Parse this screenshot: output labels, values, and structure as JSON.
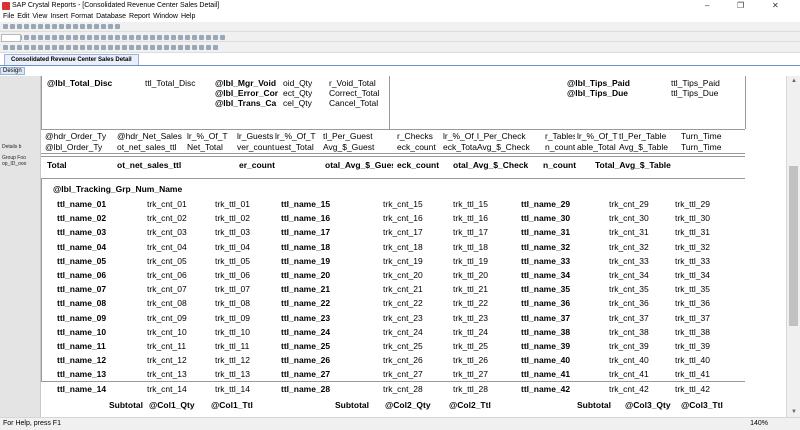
{
  "window": {
    "title": "SAP Crystal Reports - [Consolidated Revenue Center Sales Detail]",
    "minimize": "–",
    "maximize": "❐",
    "close": "✕"
  },
  "menu": [
    "File",
    "Edit",
    "View",
    "Insert",
    "Format",
    "Database",
    "Report",
    "Window",
    "Help"
  ],
  "tabs": {
    "document": "Consolidated Revenue Center Sales Detail",
    "design": "Design"
  },
  "sections": {
    "details": "Details b",
    "group_footer": "Group Foo",
    "group_footer_sub": "op_ID_ooo"
  },
  "top_block": {
    "col1": {
      "label": "@lbl_Total_Disc",
      "field": "ttl_Total_Disc"
    },
    "col2_labels": [
      "@lbl_Mgr_Void",
      "@lbl_Error_Cor",
      "@lbl_Trans_Ca"
    ],
    "col2_qty": [
      "oid_Qty",
      "ect_Qty",
      "cel_Qty"
    ],
    "col2_totals": [
      "r_Void_Total",
      "Correct_Total",
      "Cancel_Total"
    ],
    "col4_labels": [
      "@lbl_Tips_Paid",
      "@lbl_Tips_Due"
    ],
    "col4_totals": [
      "ttl_Tips_Paid",
      "ttl_Tips_Due"
    ]
  },
  "headers": [
    "@hdr_Order_Ty",
    "@hdr_Net_Sales",
    "lr_%_Of_T",
    "lr_Guests",
    "lr_%_Of_T",
    "tl_Per_Guest",
    "r_Checks",
    "lr_%_Of_T",
    "l_Per_Check",
    "r_Tables",
    "lr_%_Of_T",
    "tl_Per_Table",
    "Turn_Time"
  ],
  "detail": [
    "@lbl_Order_Ty",
    "ot_net_sales_ttl",
    "Net_Total",
    "ver_count",
    "uest_Total",
    "Avg_$_Guest",
    "eck_count",
    "eck_Total",
    "Avg_$_Check",
    "n_count",
    "able_Total",
    "Avg_$_Table",
    "Turn_Time"
  ],
  "group_footer": [
    "Total",
    "ot_net_sales_ttl",
    "er_count",
    "otal_Avg_$_Guest",
    "eck_count",
    "otal_Avg_$_Check",
    "n_count",
    "Total_Avg_$_Table"
  ],
  "tracking": {
    "title": "@lbl_Tracking_Grp_Num_Name",
    "col1": {
      "names": [
        "ttl_name_01",
        "ttl_name_02",
        "ttl_name_03",
        "ttl_name_04",
        "ttl_name_05",
        "ttl_name_06",
        "ttl_name_07",
        "ttl_name_08",
        "ttl_name_09",
        "ttl_name_10",
        "ttl_name_11",
        "ttl_name_12",
        "ttl_name_13",
        "ttl_name_14"
      ],
      "counts": [
        "trk_cnt_01",
        "trk_cnt_02",
        "trk_cnt_03",
        "trk_cnt_04",
        "trk_cnt_05",
        "trk_cnt_06",
        "trk_cnt_07",
        "trk_cnt_08",
        "trk_cnt_09",
        "trk_cnt_10",
        "trk_cnt_11",
        "trk_cnt_12",
        "trk_cnt_13",
        "trk_cnt_14"
      ],
      "totals": [
        "trk_ttl_01",
        "trk_ttl_02",
        "trk_ttl_03",
        "trk_ttl_04",
        "trk_ttl_05",
        "trk_ttl_06",
        "trk_ttl_07",
        "trk_ttl_08",
        "trk_ttl_09",
        "trk_ttl_10",
        "trk_ttl_11",
        "trk_ttl_12",
        "trk_ttl_13",
        "trk_ttl_14"
      ]
    },
    "col2": {
      "names": [
        "ttl_name_15",
        "ttl_name_16",
        "ttl_name_17",
        "ttl_name_18",
        "ttl_name_19",
        "ttl_name_20",
        "ttl_name_21",
        "ttl_name_22",
        "ttl_name_23",
        "ttl_name_24",
        "ttl_name_25",
        "ttl_name_26",
        "ttl_name_27",
        "ttl_name_28"
      ],
      "counts": [
        "trk_cnt_15",
        "trk_cnt_16",
        "trk_cnt_17",
        "trk_cnt_18",
        "trk_cnt_19",
        "trk_cnt_20",
        "trk_cnt_21",
        "trk_cnt_22",
        "trk_cnt_23",
        "trk_cnt_24",
        "trk_cnt_25",
        "trk_cnt_26",
        "trk_cnt_27",
        "trk_cnt_28"
      ],
      "totals": [
        "trk_ttl_15",
        "trk_ttl_16",
        "trk_ttl_17",
        "trk_ttl_18",
        "trk_ttl_19",
        "trk_ttl_20",
        "trk_ttl_21",
        "trk_ttl_22",
        "trk_ttl_23",
        "trk_ttl_24",
        "trk_ttl_25",
        "trk_ttl_26",
        "trk_ttl_27",
        "trk_ttl_28"
      ]
    },
    "col3": {
      "names": [
        "ttl_name_29",
        "ttl_name_30",
        "ttl_name_31",
        "ttl_name_32",
        "ttl_name_33",
        "ttl_name_34",
        "ttl_name_35",
        "ttl_name_36",
        "ttl_name_37",
        "ttl_name_38",
        "ttl_name_39",
        "ttl_name_40",
        "ttl_name_41",
        "ttl_name_42"
      ],
      "counts": [
        "trk_cnt_29",
        "trk_cnt_30",
        "trk_cnt_31",
        "trk_cnt_32",
        "trk_cnt_33",
        "trk_cnt_34",
        "trk_cnt_35",
        "trk_cnt_36",
        "trk_cnt_37",
        "trk_cnt_38",
        "trk_cnt_39",
        "trk_cnt_40",
        "trk_cnt_41",
        "trk_cnt_42"
      ],
      "totals": [
        "trk_ttl_29",
        "trk_ttl_30",
        "trk_ttl_31",
        "trk_ttl_32",
        "trk_ttl_33",
        "trk_ttl_34",
        "trk_ttl_35",
        "trk_ttl_36",
        "trk_ttl_37",
        "trk_ttl_38",
        "trk_ttl_39",
        "trk_ttl_40",
        "trk_ttl_41",
        "trk_ttl_42"
      ]
    },
    "subtotal_label": "Subtotal",
    "subtotals": [
      "@Col1_Qty",
      "@Col1_Ttl",
      "@Col2_Qty",
      "@Col2_Ttl",
      "@Col3_Qty",
      "@Col3_Ttl"
    ]
  },
  "status": {
    "help": "For Help, press F1",
    "zoom": "140%"
  }
}
